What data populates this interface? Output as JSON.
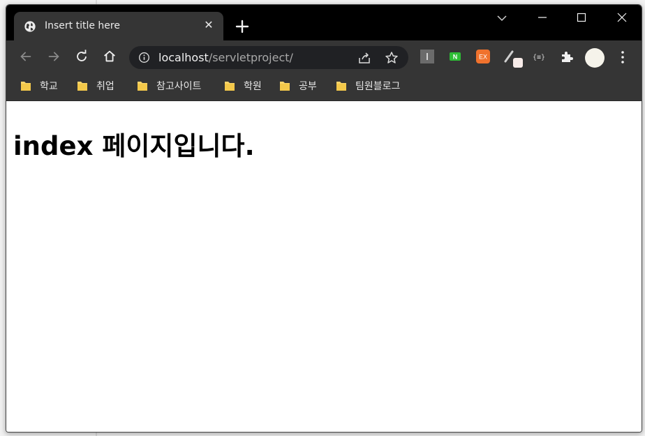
{
  "browser": {
    "tab": {
      "title": "Insert title here",
      "favicon": "globe-icon"
    },
    "address_bar": {
      "host": "localhost",
      "path": "/servletproject/"
    },
    "extensions": [
      {
        "name": "ext-i-icon",
        "label": "I",
        "color": "#6b6b6b"
      },
      {
        "name": "ext-n-icon",
        "label": "N",
        "color": "#2dbe35"
      },
      {
        "name": "ext-ex-icon",
        "label": "EX",
        "color": "#f0722d"
      },
      {
        "name": "ext-pen-icon",
        "label": "",
        "color": "#cfcfcf"
      },
      {
        "name": "ext-braces-icon",
        "label": "{≡}",
        "color": "#d0d0d0"
      }
    ]
  },
  "bookmarks": [
    {
      "label": "학교"
    },
    {
      "label": "취업"
    },
    {
      "label": "참고사이트"
    },
    {
      "label": "학원"
    },
    {
      "label": "공부"
    },
    {
      "label": "팀원블로그"
    }
  ],
  "page": {
    "heading": "index 페이지입니다."
  },
  "colors": {
    "chrome_dark": "#353535",
    "tabstrip": "#000000",
    "folder": "#f7d46a"
  }
}
